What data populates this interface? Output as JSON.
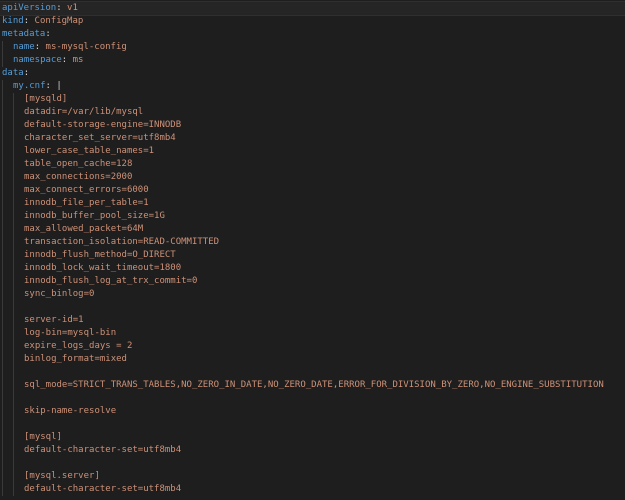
{
  "lines": [
    {
      "indent": 0,
      "key": "apiVersion",
      "value": "v1"
    },
    {
      "indent": 0,
      "key": "kind",
      "value": "ConfigMap"
    },
    {
      "indent": 0,
      "key": "metadata",
      "value": ""
    },
    {
      "indent": 1,
      "key": "name",
      "value": "ms-mysql-config"
    },
    {
      "indent": 1,
      "key": "namespace",
      "value": "ms"
    },
    {
      "indent": 0,
      "key": "data",
      "value": ""
    },
    {
      "indent": 1,
      "key": "my.cnf",
      "value": "|"
    },
    {
      "indent": 2,
      "text": "[mysqld]"
    },
    {
      "indent": 2,
      "text": "datadir=/var/lib/mysql"
    },
    {
      "indent": 2,
      "text": "default-storage-engine=INNODB"
    },
    {
      "indent": 2,
      "text": "character_set_server=utf8mb4"
    },
    {
      "indent": 2,
      "text": "lower_case_table_names=1"
    },
    {
      "indent": 2,
      "text": "table_open_cache=128"
    },
    {
      "indent": 2,
      "text": "max_connections=2000"
    },
    {
      "indent": 2,
      "text": "max_connect_errors=6000"
    },
    {
      "indent": 2,
      "text": "innodb_file_per_table=1"
    },
    {
      "indent": 2,
      "text": "innodb_buffer_pool_size=1G"
    },
    {
      "indent": 2,
      "text": "max_allowed_packet=64M"
    },
    {
      "indent": 2,
      "text": "transaction_isolation=READ-COMMITTED"
    },
    {
      "indent": 2,
      "text": "innodb_flush_method=O_DIRECT"
    },
    {
      "indent": 2,
      "text": "innodb_lock_wait_timeout=1800"
    },
    {
      "indent": 2,
      "text": "innodb_flush_log_at_trx_commit=0"
    },
    {
      "indent": 2,
      "text": "sync_binlog=0"
    },
    {
      "indent": 2,
      "text": ""
    },
    {
      "indent": 2,
      "text": "server-id=1"
    },
    {
      "indent": 2,
      "text": "log-bin=mysql-bin"
    },
    {
      "indent": 2,
      "text": "expire_logs_days = 2"
    },
    {
      "indent": 2,
      "text": "binlog_format=mixed"
    },
    {
      "indent": 2,
      "text": ""
    },
    {
      "indent": 2,
      "text": "sql_mode=STRICT_TRANS_TABLES,NO_ZERO_IN_DATE,NO_ZERO_DATE,ERROR_FOR_DIVISION_BY_ZERO,NO_ENGINE_SUBSTITUTION"
    },
    {
      "indent": 2,
      "text": ""
    },
    {
      "indent": 2,
      "text": "skip-name-resolve"
    },
    {
      "indent": 2,
      "text": ""
    },
    {
      "indent": 2,
      "text": "[mysql]"
    },
    {
      "indent": 2,
      "text": "default-character-set=utf8mb4"
    },
    {
      "indent": 2,
      "text": ""
    },
    {
      "indent": 2,
      "text": "[mysql.server]"
    },
    {
      "indent": 2,
      "text": "default-character-set=utf8mb4"
    }
  ],
  "colors": {
    "background": "#1e1e1e",
    "key": "#569cd6",
    "string": "#ce9178",
    "text": "#d4d4d4"
  }
}
